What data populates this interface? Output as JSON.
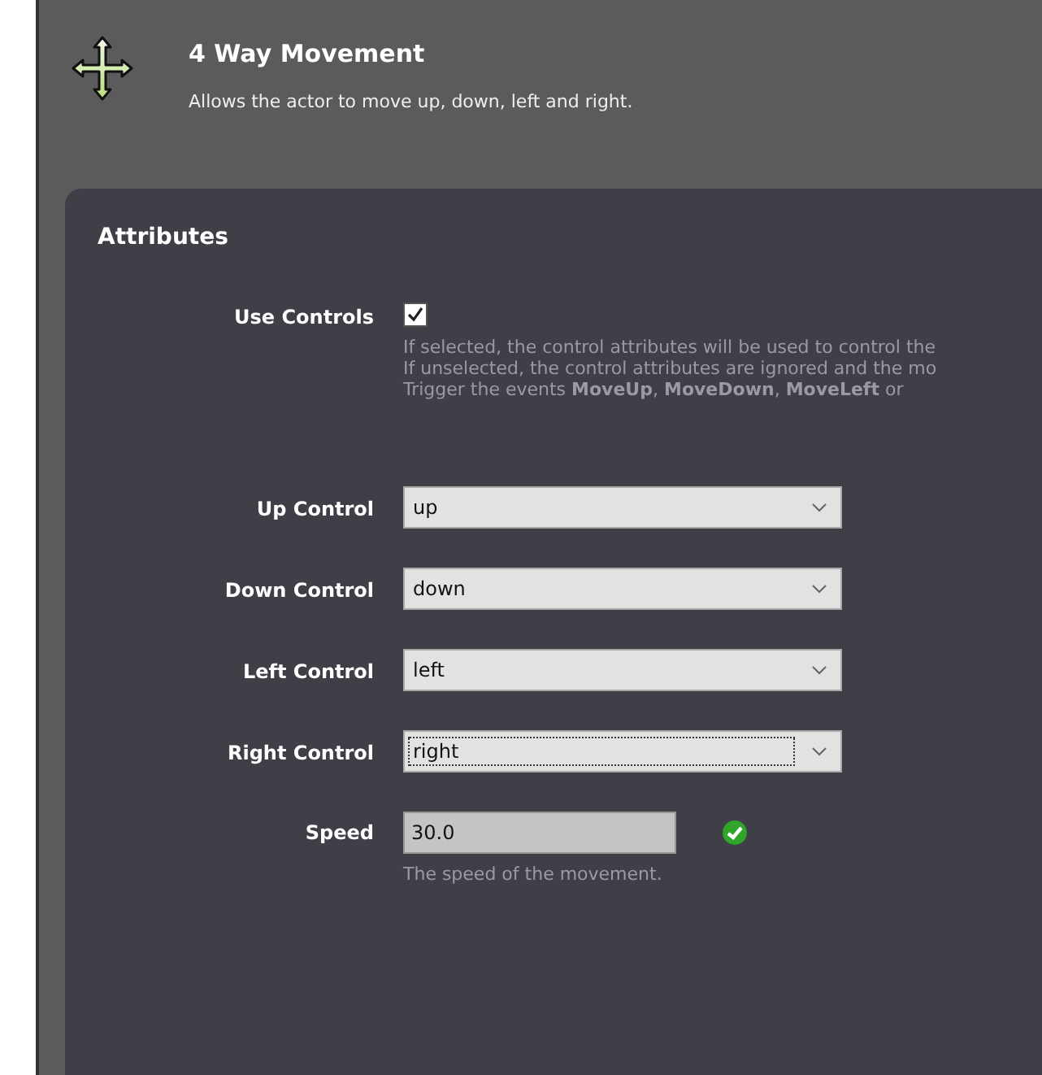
{
  "header": {
    "title": "4 Way Movement",
    "description": "Allows the actor to move up, down, left and right."
  },
  "attributes": {
    "title": "Attributes",
    "use_controls": {
      "label": "Use Controls",
      "checked": true,
      "help": [
        "If selected, the control attributes will be used to control the",
        "If unselected, the control attributes are ignored and the mo",
        "Trigger the events **MoveUp**, **MoveDown**, **MoveLeft** or"
      ]
    },
    "controls": [
      {
        "label": "Up Control",
        "value": "up",
        "focused": false
      },
      {
        "label": "Down Control",
        "value": "down",
        "focused": false
      },
      {
        "label": "Left Control",
        "value": "left",
        "focused": false
      },
      {
        "label": "Right Control",
        "value": "right",
        "focused": true
      }
    ],
    "speed": {
      "label": "Speed",
      "value": "30.0",
      "valid": true,
      "help": "The speed of the movement."
    }
  }
}
